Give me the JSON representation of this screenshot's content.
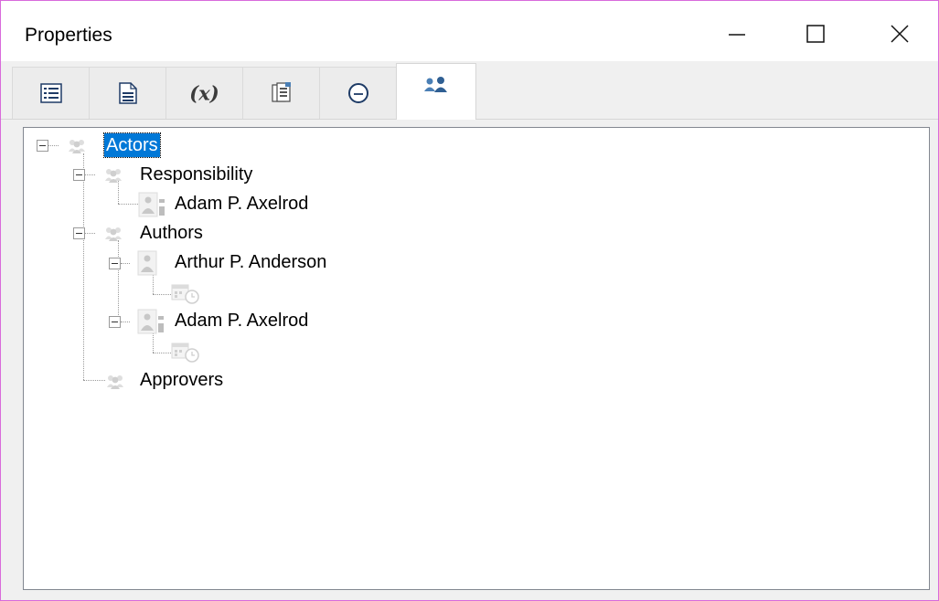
{
  "window": {
    "title": "Properties",
    "controls": [
      "minimize-icon",
      "maximize-icon",
      "close-icon"
    ],
    "border_color": "#d86adb"
  },
  "tabs": [
    {
      "icon": "list-icon",
      "active": false
    },
    {
      "icon": "document-icon",
      "active": false
    },
    {
      "icon": "variable-icon",
      "label": "(x)",
      "active": false
    },
    {
      "icon": "report-icon",
      "active": false
    },
    {
      "icon": "clock-icon",
      "active": false
    },
    {
      "icon": "users-icon",
      "active": true
    }
  ],
  "tree": {
    "root": {
      "label": "Actors",
      "selected": true,
      "icon": "group-icon"
    },
    "responsibility": {
      "label": "Responsibility",
      "icon": "group-icon"
    },
    "responsibility_person": {
      "label": "Adam P. Axelrod",
      "icon": "person-icon"
    },
    "authors": {
      "label": "Authors",
      "icon": "group-icon"
    },
    "author_1": {
      "label": "Arthur P. Anderson",
      "icon": "person-icon"
    },
    "author_1_child": {
      "icon": "calendar-clock-icon"
    },
    "author_2": {
      "label": "Adam P. Axelrod",
      "icon": "person-icon"
    },
    "author_2_child": {
      "icon": "calendar-clock-icon"
    },
    "approvers": {
      "label": "Approvers",
      "icon": "group-icon"
    }
  },
  "colors": {
    "selection": "#0078d7",
    "accent_icon": "#4a7fb5"
  }
}
